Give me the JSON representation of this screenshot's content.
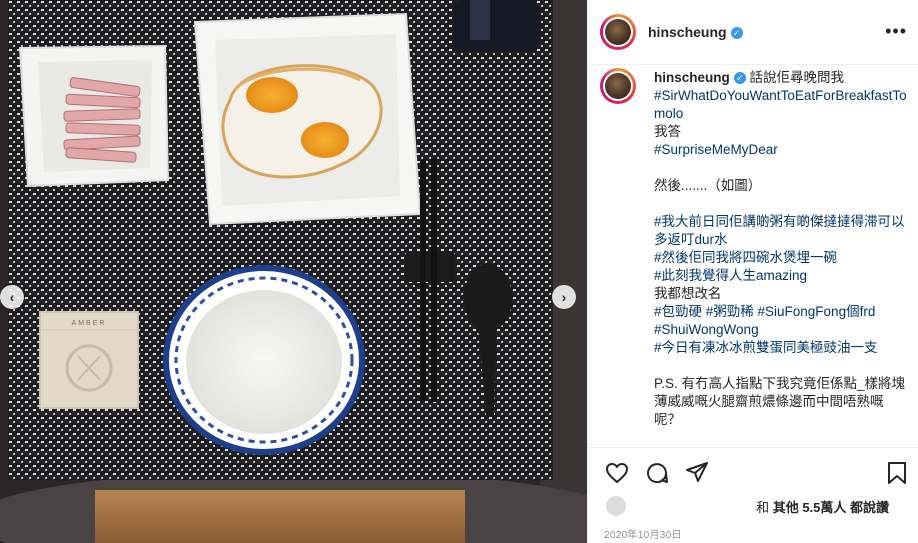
{
  "post": {
    "username": "hinscheung",
    "more_label": "•••",
    "caption": {
      "user": "hinscheung",
      "lines": [
        {
          "text": "話說佢尋晚問我",
          "tag": false,
          "first": true
        },
        {
          "text": "#SirWhatDoYouWantToEatForBreakfastTomolo",
          "tag": true
        },
        {
          "text": "我答",
          "tag": false
        },
        {
          "text": "#SurpriseMeMyDear",
          "tag": true
        },
        {
          "text": "",
          "tag": false
        },
        {
          "text": "然後.......（如圖）",
          "tag": false
        },
        {
          "text": "",
          "tag": false
        },
        {
          "text": "#我大前日同佢講啲粥有啲傑撻撻得滞可以多返叮dur水",
          "tag": true
        },
        {
          "text": "#然後佢同我將四碗水煲埋一碗",
          "tag": true
        },
        {
          "text": "#此刻我覺得人生amazing",
          "tag": true
        },
        {
          "text": "我都想改名",
          "tag": false
        },
        {
          "text": "#包勁硬 #粥勁稀 #SiuFongFong個frd",
          "tag": true
        },
        {
          "text": "#ShuiWongWong",
          "tag": true
        },
        {
          "text": "#今日有凍冰冰煎雙蛋同美極豉油一支",
          "tag": true
        },
        {
          "text": "",
          "tag": false
        },
        {
          "text": "P.S. 有冇高人指點下我究竟佢係點_樣將塊薄威威嘅火腿齋煎燶條邊而中間唔熟嘅呢？",
          "tag": false
        }
      ]
    },
    "likes": {
      "prefix": "和 ",
      "rest": "其他 5.5萬人 都說讚"
    },
    "date": "2020年10月30日"
  },
  "photo": {
    "box_label": "AMBER"
  }
}
